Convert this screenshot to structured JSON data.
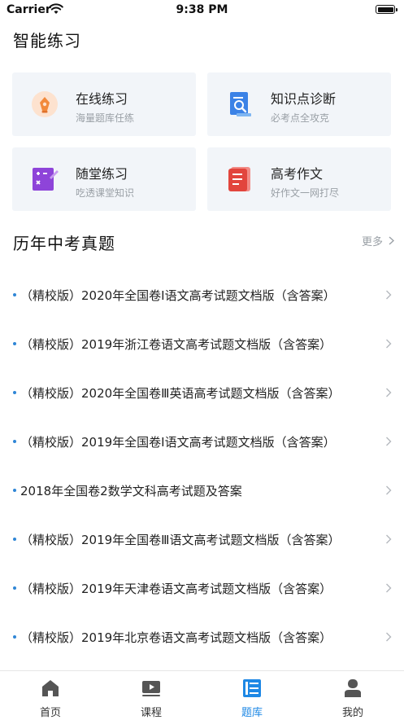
{
  "status": {
    "carrier": "Carrier",
    "time": "9:38 PM"
  },
  "practice": {
    "title": "智能练习",
    "cards": [
      {
        "title": "在线练习",
        "subtitle": "海量题库任练",
        "icon": "pen-nib-icon"
      },
      {
        "title": "知识点诊断",
        "subtitle": "必考点全攻克",
        "icon": "document-search-icon"
      },
      {
        "title": "随堂练习",
        "subtitle": "吃透课堂知识",
        "icon": "math-notebook-icon"
      },
      {
        "title": "高考作文",
        "subtitle": "好作文一网打尽",
        "icon": "essay-book-icon"
      }
    ]
  },
  "exams": {
    "title": "历年中考真题",
    "more_label": "更多",
    "items": [
      "（精校版）2020年全国卷Ⅰ语文高考试题文档版（含答案）",
      "（精校版）2019年浙江卷语文高考试题文档版（含答案）",
      "（精校版）2020年全国卷Ⅲ英语高考试题文档版（含答案）",
      "（精校版）2019年全国卷Ⅰ语文高考试题文档版（含答案）",
      "2018年全国卷2数学文科高考试题及答案",
      "（精校版）2019年全国卷Ⅲ语文高考试题文档版（含答案）",
      "（精校版）2019年天津卷语文高考试题文档版（含答案）",
      "（精校版）2019年北京卷语文高考试题文档版（含答案）"
    ]
  },
  "tabbar": {
    "active_color": "#1e88e5",
    "tabs": [
      {
        "label": "首页",
        "icon": "home-icon"
      },
      {
        "label": "课程",
        "icon": "video-play-icon"
      },
      {
        "label": "题库",
        "icon": "question-bank-icon",
        "active": true
      },
      {
        "label": "我的",
        "icon": "user-icon"
      }
    ]
  }
}
